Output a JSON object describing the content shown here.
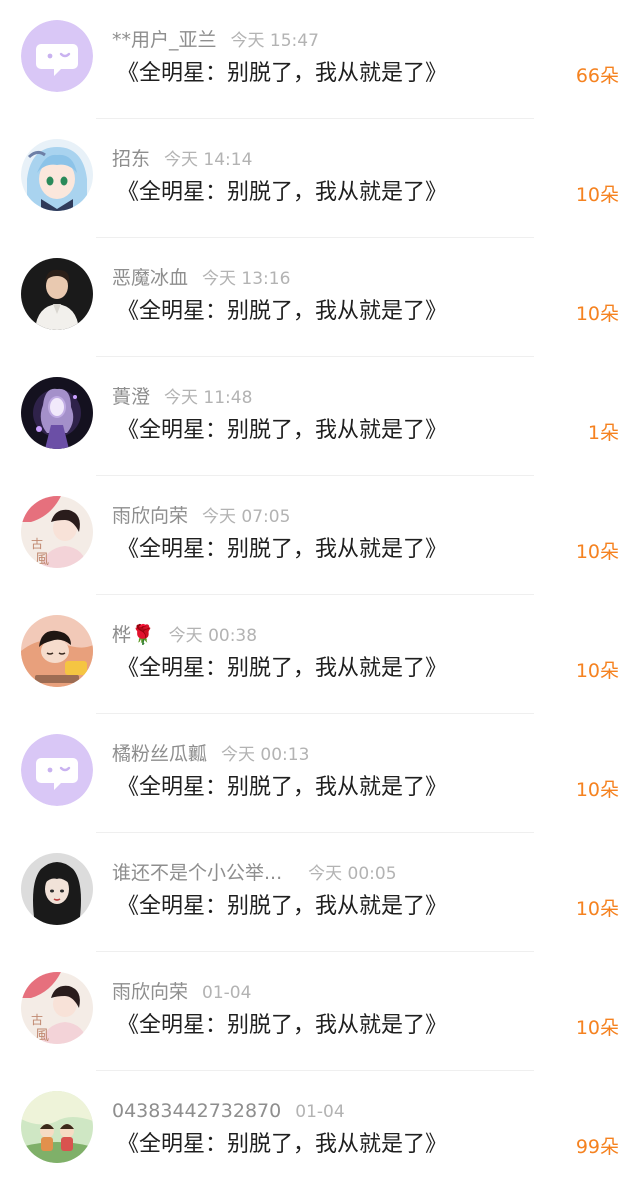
{
  "accent_color": "#f58220",
  "items": [
    {
      "user": "**用户_亚兰",
      "time": "今天 15:47",
      "title": "《全明星：别脱了，我从就是了》",
      "flowers": "66朵",
      "avatar": "default-chat-avatar"
    },
    {
      "user": "招东",
      "time": "今天 14:14",
      "title": "《全明星：别脱了，我从就是了》",
      "flowers": "10朵",
      "avatar": "anime-girl-avatar"
    },
    {
      "user": "恶魔冰血",
      "time": "今天 13:16",
      "title": "《全明星：别脱了，我从就是了》",
      "flowers": "10朵",
      "avatar": "man-portrait-avatar"
    },
    {
      "user": "蕢澄",
      "time": "今天 11:48",
      "title": "《全明星：别脱了，我从就是了》",
      "flowers": "1朵",
      "avatar": "fantasy-character-avatar"
    },
    {
      "user": "雨欣向荣",
      "time": "今天 07:05",
      "title": "《全明星：别脱了，我从就是了》",
      "flowers": "10朵",
      "avatar": "gufeng-girl-avatar"
    },
    {
      "user": "桦🌹",
      "time": "今天 00:38",
      "title": "《全明星：别脱了，我从就是了》",
      "flowers": "10朵",
      "avatar": "sleeping-girl-avatar"
    },
    {
      "user": "橘粉丝瓜瓤",
      "time": "今天 00:13",
      "title": "《全明星：别脱了，我从就是了》",
      "flowers": "10朵",
      "avatar": "default-chat-avatar"
    },
    {
      "user": "谁还不是个小公举...",
      "time": "今天 00:05",
      "title": "《全明星：别脱了，我从就是了》",
      "flowers": "10朵",
      "avatar": "dark-hair-girl-avatar"
    },
    {
      "user": "雨欣向荣",
      "time": "01-04",
      "title": "《全明星：别脱了，我从就是了》",
      "flowers": "10朵",
      "avatar": "gufeng-girl-avatar"
    },
    {
      "user": "04383442732870",
      "time": "01-04",
      "title": "《全明星：别脱了，我从就是了》",
      "flowers": "99朵",
      "avatar": "cartoon-kids-avatar"
    }
  ]
}
